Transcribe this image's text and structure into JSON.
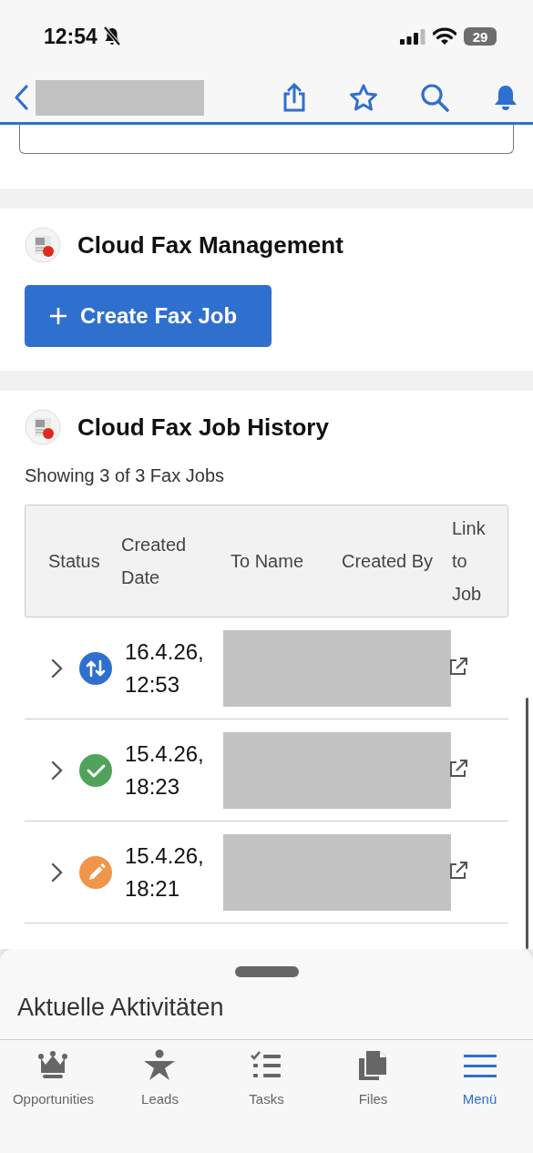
{
  "status_bar": {
    "time": "12:54",
    "battery": "29"
  },
  "management": {
    "title": "Cloud Fax Management",
    "button": "Create Fax Job"
  },
  "history": {
    "title": "Cloud Fax Job History",
    "summary": "Showing 3 of 3 Fax Jobs",
    "columns": [
      "Status",
      "Created Date",
      "To Name",
      "Created By",
      "Link to Job"
    ],
    "rows": [
      {
        "kind": "in-progress",
        "color": "#2f6fd0",
        "created": "16.4.26, 12:53",
        "expanded": false
      },
      {
        "kind": "done",
        "color": "#4fa35a",
        "created": "15.4.26, 18:23",
        "expanded": false
      },
      {
        "kind": "draft",
        "color": "#f0954a",
        "created": "15.4.26, 18:21",
        "expanded": false
      }
    ]
  },
  "bottom_sheet": {
    "title": "Aktuelle Aktivitäten"
  },
  "tab_bar": [
    {
      "kind": "crown",
      "label": "Opportunities",
      "selected": false
    },
    {
      "kind": "person",
      "label": "Leads",
      "selected": false
    },
    {
      "kind": "tasks",
      "label": "Tasks",
      "selected": false
    },
    {
      "kind": "files",
      "label": "Files",
      "selected": false
    },
    {
      "kind": "menu",
      "label": "Menü",
      "selected": true
    }
  ]
}
